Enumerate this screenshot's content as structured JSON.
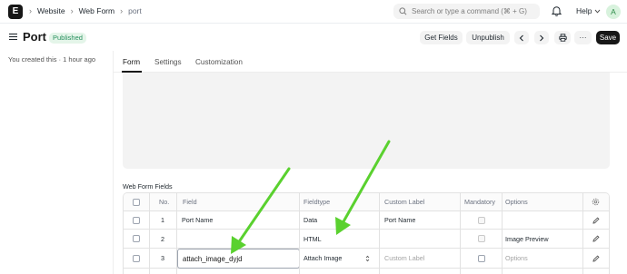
{
  "navbar": {
    "logo": "E",
    "breadcrumbs": [
      "Website",
      "Web Form",
      "port"
    ],
    "search_placeholder": "Search or type a command (⌘ + G)",
    "help_label": "Help",
    "avatar_initial": "A"
  },
  "page": {
    "title": "Port",
    "status": "Published",
    "buttons": {
      "get_fields": "Get Fields",
      "unpublish": "Unpublish",
      "more": "···",
      "save": "Save"
    }
  },
  "sidebar": {
    "created_note": "You created this · 1 hour ago"
  },
  "tabs": [
    "Form",
    "Settings",
    "Customization"
  ],
  "web_form_fields": {
    "label": "Web Form Fields",
    "columns": [
      "No.",
      "Field",
      "Fieldtype",
      "Custom Label",
      "Mandatory",
      "Options"
    ],
    "rows": [
      {
        "no": "1",
        "field": "Port Name",
        "fieldtype": "Data",
        "custom_label": "Port Name",
        "options": ""
      },
      {
        "no": "2",
        "field": "",
        "fieldtype": "HTML",
        "custom_label": "",
        "options": "Image Preview"
      },
      {
        "no": "3",
        "field": "attach_image_dyjd",
        "fieldtype": "Attach Image",
        "custom_label": "Custom Label",
        "options": "Options"
      }
    ]
  },
  "colors": {
    "accent": "#171717",
    "badge_bg": "#e4f5e9",
    "badge_text": "#278f5e",
    "arrow": "#5ad12f"
  },
  "icons": [
    "logo-icon",
    "chevron-right-icon",
    "search-icon",
    "bell-icon",
    "chevron-down-icon",
    "menu-icon",
    "chevron-left-icon",
    "printer-icon",
    "settings-icon",
    "edit-icon",
    "arrow-annotation"
  ]
}
